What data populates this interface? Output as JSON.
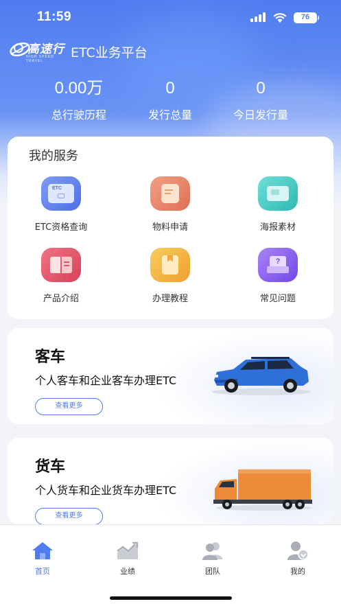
{
  "status_bar": {
    "time": "11:59",
    "battery": "76"
  },
  "header": {
    "logo_text": "高速行",
    "logo_subtext": "HIGH SPEED TRAVEL",
    "title": "ETC业务平台"
  },
  "stats": [
    {
      "value": "0.00万",
      "label": "总行驶历程"
    },
    {
      "value": "0",
      "label": "发行总量"
    },
    {
      "value": "0",
      "label": "今日发行量"
    }
  ],
  "services": {
    "title": "我的服务",
    "items": [
      {
        "label": "ETC资格查询",
        "icon": "etc-card-icon",
        "color": "#5b7ff0"
      },
      {
        "label": "物料申请",
        "icon": "material-icon",
        "color": "#e9866a"
      },
      {
        "label": "海报素材",
        "icon": "poster-icon",
        "color": "#3ec8c2"
      },
      {
        "label": "产品介绍",
        "icon": "book-icon",
        "color": "#e5566a"
      },
      {
        "label": "办理教程",
        "icon": "tutorial-icon",
        "color": "#f2b43a"
      },
      {
        "label": "常见问题",
        "icon": "faq-icon",
        "color": "#8f5cf0"
      }
    ],
    "etc_badge": "ETC"
  },
  "vehicles": [
    {
      "title": "客车",
      "description": "个人客车和企业客车办理ETC",
      "button": "查看更多"
    },
    {
      "title": "货车",
      "description": "个人货车和企业货车办理ETC",
      "button": "查看更多"
    }
  ],
  "tabbar": [
    {
      "label": "首页",
      "icon": "home-icon",
      "active": true
    },
    {
      "label": "业绩",
      "icon": "performance-icon",
      "active": false
    },
    {
      "label": "团队",
      "icon": "team-icon",
      "active": false
    },
    {
      "label": "我的",
      "icon": "profile-icon",
      "active": false
    }
  ],
  "colors": {
    "accent": "#4f7cf0",
    "header_gradient_top": "#4f7cf0",
    "page_background": "#f2f4f8"
  }
}
